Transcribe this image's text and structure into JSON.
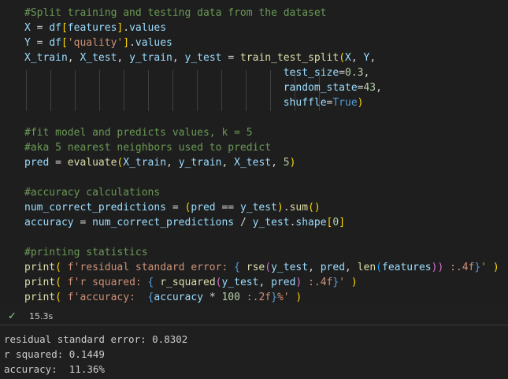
{
  "code_lines": [
    [
      {
        "t": "#Split training and testing data from the dataset",
        "c": "com"
      }
    ],
    [
      {
        "t": "X",
        "c": "var"
      },
      {
        "t": " = ",
        "c": "op"
      },
      {
        "t": "df",
        "c": "var"
      },
      {
        "t": "[",
        "c": "b1"
      },
      {
        "t": "features",
        "c": "var"
      },
      {
        "t": "]",
        "c": "b1"
      },
      {
        "t": ".",
        "c": "op"
      },
      {
        "t": "values",
        "c": "var"
      }
    ],
    [
      {
        "t": "Y",
        "c": "var"
      },
      {
        "t": " = ",
        "c": "op"
      },
      {
        "t": "df",
        "c": "var"
      },
      {
        "t": "[",
        "c": "b1"
      },
      {
        "t": "'quality'",
        "c": "str"
      },
      {
        "t": "]",
        "c": "b1"
      },
      {
        "t": ".",
        "c": "op"
      },
      {
        "t": "values",
        "c": "var"
      }
    ],
    [
      {
        "t": "X_train",
        "c": "var"
      },
      {
        "t": ", ",
        "c": "op"
      },
      {
        "t": "X_test",
        "c": "var"
      },
      {
        "t": ", ",
        "c": "op"
      },
      {
        "t": "y_train",
        "c": "var"
      },
      {
        "t": ", ",
        "c": "op"
      },
      {
        "t": "y_test",
        "c": "var"
      },
      {
        "t": " = ",
        "c": "op"
      },
      {
        "t": "train_test_split",
        "c": "fn"
      },
      {
        "t": "(",
        "c": "b1"
      },
      {
        "t": "X",
        "c": "var"
      },
      {
        "t": ", ",
        "c": "op"
      },
      {
        "t": "Y",
        "c": "var"
      },
      {
        "t": ",",
        "c": "op"
      }
    ],
    [
      {
        "t": "                                          ",
        "c": "op"
      },
      {
        "t": "test_size",
        "c": "var"
      },
      {
        "t": "=",
        "c": "op"
      },
      {
        "t": "0.3",
        "c": "num"
      },
      {
        "t": ",",
        "c": "op"
      }
    ],
    [
      {
        "t": "                                          ",
        "c": "op"
      },
      {
        "t": "random_state",
        "c": "var"
      },
      {
        "t": "=",
        "c": "op"
      },
      {
        "t": "43",
        "c": "num"
      },
      {
        "t": ",",
        "c": "op"
      }
    ],
    [
      {
        "t": "                                          ",
        "c": "op"
      },
      {
        "t": "shuffle",
        "c": "var"
      },
      {
        "t": "=",
        "c": "op"
      },
      {
        "t": "True",
        "c": "kw"
      },
      {
        "t": ")",
        "c": "b1"
      }
    ],
    [
      {
        "t": "",
        "c": "op"
      }
    ],
    [
      {
        "t": "#fit model and predicts values, k = 5",
        "c": "com"
      }
    ],
    [
      {
        "t": "#aka 5 nearest neighbors used to predict",
        "c": "com"
      }
    ],
    [
      {
        "t": "pred",
        "c": "var"
      },
      {
        "t": " = ",
        "c": "op"
      },
      {
        "t": "evaluate",
        "c": "fn"
      },
      {
        "t": "(",
        "c": "b1"
      },
      {
        "t": "X_train",
        "c": "var"
      },
      {
        "t": ", ",
        "c": "op"
      },
      {
        "t": "y_train",
        "c": "var"
      },
      {
        "t": ", ",
        "c": "op"
      },
      {
        "t": "X_test",
        "c": "var"
      },
      {
        "t": ", ",
        "c": "op"
      },
      {
        "t": "5",
        "c": "num"
      },
      {
        "t": ")",
        "c": "b1"
      }
    ],
    [
      {
        "t": "",
        "c": "op"
      }
    ],
    [
      {
        "t": "#accuracy calculations",
        "c": "com"
      }
    ],
    [
      {
        "t": "num_correct_predictions",
        "c": "var"
      },
      {
        "t": " = ",
        "c": "op"
      },
      {
        "t": "(",
        "c": "b1"
      },
      {
        "t": "pred",
        "c": "var"
      },
      {
        "t": " == ",
        "c": "op"
      },
      {
        "t": "y_test",
        "c": "var"
      },
      {
        "t": ")",
        "c": "b1"
      },
      {
        "t": ".",
        "c": "op"
      },
      {
        "t": "sum",
        "c": "fn"
      },
      {
        "t": "()",
        "c": "b1"
      }
    ],
    [
      {
        "t": "accuracy",
        "c": "var"
      },
      {
        "t": " = ",
        "c": "op"
      },
      {
        "t": "num_correct_predictions",
        "c": "var"
      },
      {
        "t": " / ",
        "c": "op"
      },
      {
        "t": "y_test",
        "c": "var"
      },
      {
        "t": ".",
        "c": "op"
      },
      {
        "t": "shape",
        "c": "var"
      },
      {
        "t": "[",
        "c": "b1"
      },
      {
        "t": "0",
        "c": "num"
      },
      {
        "t": "]",
        "c": "b1"
      }
    ],
    [
      {
        "t": "",
        "c": "op"
      }
    ],
    [
      {
        "t": "#printing statistics",
        "c": "com"
      }
    ],
    [
      {
        "t": "print",
        "c": "fn"
      },
      {
        "t": "( ",
        "c": "b1"
      },
      {
        "t": "f'residual standard error: ",
        "c": "str"
      },
      {
        "t": "{ ",
        "c": "kw"
      },
      {
        "t": "rse",
        "c": "fn"
      },
      {
        "t": "(",
        "c": "b2"
      },
      {
        "t": "y_test",
        "c": "var"
      },
      {
        "t": ", ",
        "c": "op"
      },
      {
        "t": "pred",
        "c": "var"
      },
      {
        "t": ", ",
        "c": "op"
      },
      {
        "t": "len",
        "c": "fn"
      },
      {
        "t": "(",
        "c": "b3"
      },
      {
        "t": "features",
        "c": "var"
      },
      {
        "t": "))",
        "c": "b2"
      },
      {
        "t": " :.4f",
        "c": "str"
      },
      {
        "t": "}",
        "c": "kw"
      },
      {
        "t": "' ",
        "c": "str"
      },
      {
        "t": ")",
        "c": "b1"
      }
    ],
    [
      {
        "t": "print",
        "c": "fn"
      },
      {
        "t": "( ",
        "c": "b1"
      },
      {
        "t": "f'r squared: ",
        "c": "str"
      },
      {
        "t": "{ ",
        "c": "kw"
      },
      {
        "t": "r_squared",
        "c": "fn"
      },
      {
        "t": "(",
        "c": "b2"
      },
      {
        "t": "y_test",
        "c": "var"
      },
      {
        "t": ", ",
        "c": "op"
      },
      {
        "t": "pred",
        "c": "var"
      },
      {
        "t": ")",
        "c": "b2"
      },
      {
        "t": " :.4f",
        "c": "str"
      },
      {
        "t": "}",
        "c": "kw"
      },
      {
        "t": "' ",
        "c": "str"
      },
      {
        "t": ")",
        "c": "b1"
      }
    ],
    [
      {
        "t": "print",
        "c": "fn"
      },
      {
        "t": "( ",
        "c": "b1"
      },
      {
        "t": "f'accuracy:  ",
        "c": "str"
      },
      {
        "t": "{",
        "c": "kw"
      },
      {
        "t": "accuracy",
        "c": "var"
      },
      {
        "t": " * ",
        "c": "op"
      },
      {
        "t": "100",
        "c": "num"
      },
      {
        "t": " :.2f",
        "c": "str"
      },
      {
        "t": "}",
        "c": "kw"
      },
      {
        "t": "%' ",
        "c": "str"
      },
      {
        "t": ")",
        "c": "b1"
      }
    ]
  ],
  "status": {
    "check_icon": "check-icon",
    "duration": "15.3s"
  },
  "output_lines": [
    "residual standard error: 0.8302",
    "r squared: 0.1449",
    "accuracy:  11.36%"
  ],
  "colors": {
    "background": "#1e1e1e",
    "comment": "#6a9955",
    "variable": "#9cdcfe",
    "function": "#dcdcaa",
    "string": "#ce9178",
    "number": "#b5cea8",
    "keyword": "#569cd6",
    "success": "#89d185"
  }
}
